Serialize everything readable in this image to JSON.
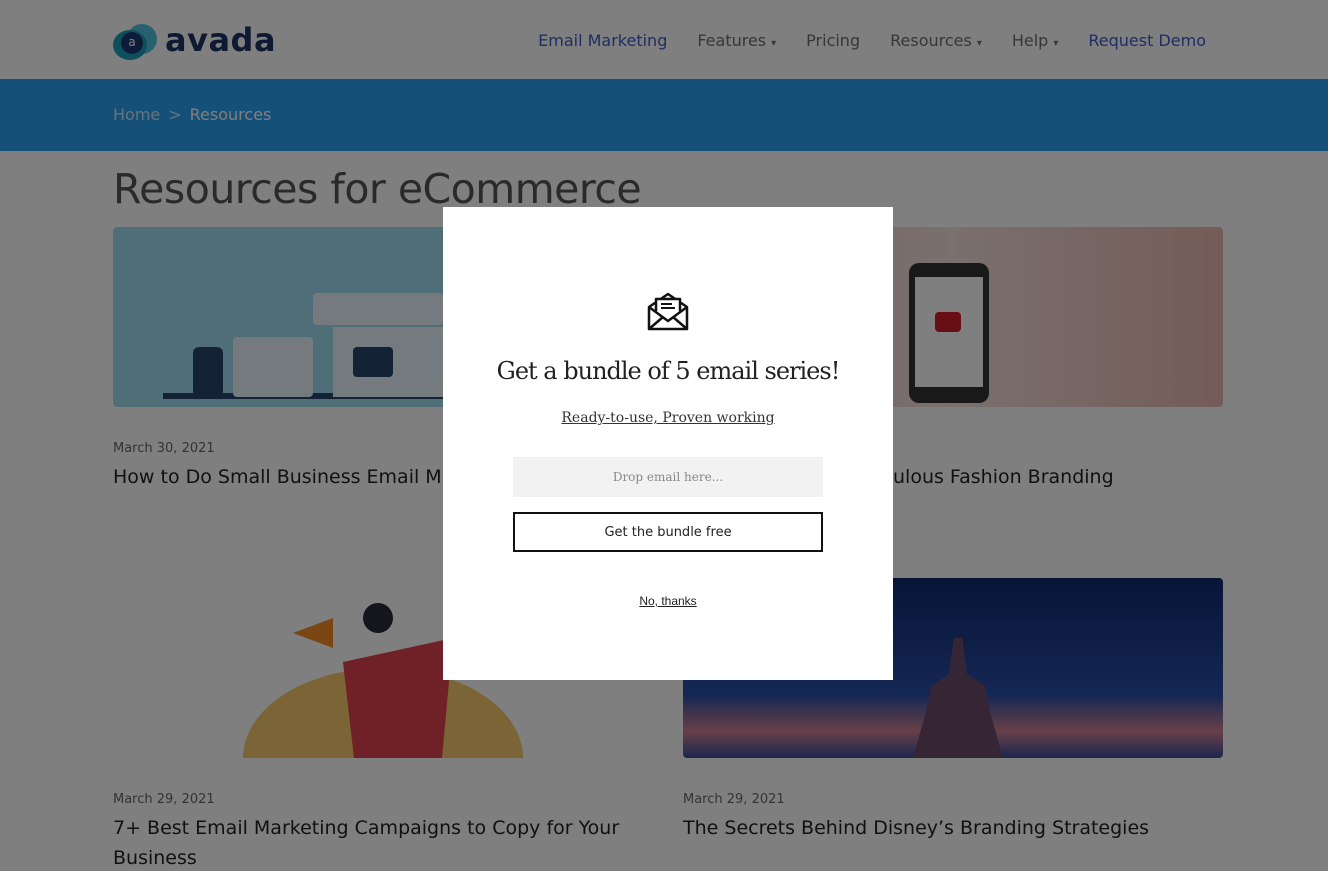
{
  "header": {
    "logo_text": "avada",
    "logo_mark_letter": "a",
    "nav": [
      {
        "label": "Email Marketing",
        "dropdown": false
      },
      {
        "label": "Features",
        "dropdown": true
      },
      {
        "label": "Pricing",
        "dropdown": false
      },
      {
        "label": "Resources",
        "dropdown": true
      },
      {
        "label": "Help",
        "dropdown": true
      },
      {
        "label": "Request Demo",
        "dropdown": false
      }
    ],
    "chevron": "⌄"
  },
  "breadcrumb": {
    "home": "Home",
    "separator": ">",
    "current": "Resources"
  },
  "page_title": "Resources for eCommerce",
  "articles": [
    {
      "date": "March 30, 2021",
      "title": "How to Do Small Business Email M"
    },
    {
      "date": "",
      "title": "ulous Fashion Branding"
    },
    {
      "date": "March 29, 2021",
      "title": "7+ Best Email Marketing Campaigns to Copy for Your Business"
    },
    {
      "date": "March 29, 2021",
      "title": "The Secrets Behind Disney’s Branding Strategies"
    }
  ],
  "modal": {
    "icon": "open-envelope-icon",
    "title": "Get a bundle of 5 email series!",
    "subtitle": "Ready-to-use, Proven working",
    "email_placeholder": "Drop email here...",
    "email_value": "",
    "submit_label": "Get the bundle free",
    "decline_label": "No, thanks"
  },
  "colors": {
    "brand": "#1d3264",
    "accent_link": "#3b5cc9",
    "band": "#2ba0f0"
  }
}
